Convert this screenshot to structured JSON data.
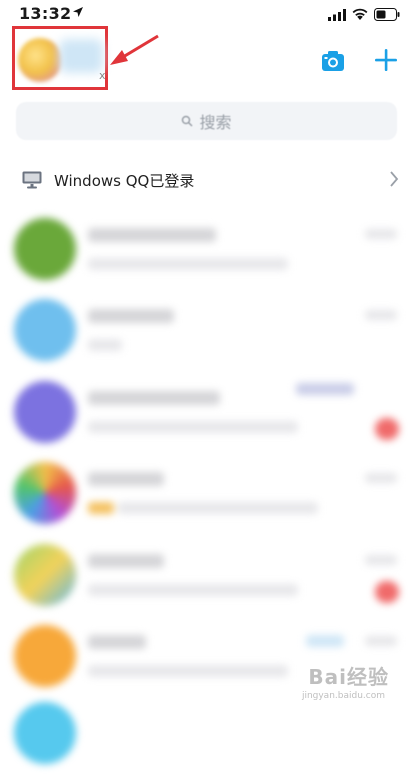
{
  "status_bar": {
    "time": "13:32"
  },
  "header": {
    "profile_x_mark": "x",
    "colors": {
      "highlight": "#e0353a",
      "accent": "#1aa0e6"
    },
    "icons": [
      "camera-icon",
      "plus-icon"
    ]
  },
  "search": {
    "placeholder": "搜索"
  },
  "device_notice": {
    "text": "Windows QQ已登录"
  },
  "watermark": {
    "text": "Bai经验",
    "sub": "jingyan.baidu.com"
  }
}
